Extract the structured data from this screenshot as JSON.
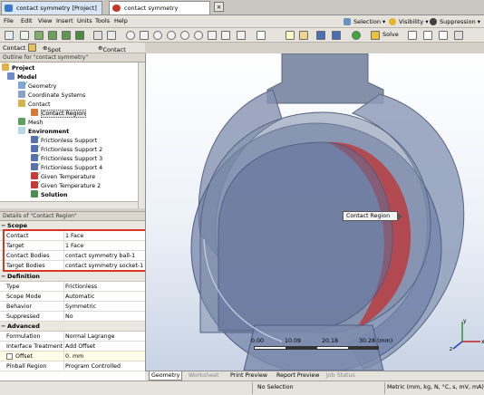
{
  "tabs": [
    {
      "label": "contact symmetry [Project]"
    },
    {
      "label": "contact symmetry [Simulation]"
    }
  ],
  "menu": [
    "File",
    "Edit",
    "View",
    "Insert",
    "Units",
    "Tools",
    "Help"
  ],
  "menu_right": {
    "selection": "Selection",
    "visibility": "Visibility",
    "suppression": "Suppression"
  },
  "toolbar": {
    "solve": "Solve"
  },
  "context_bar": {
    "contact": "Contact",
    "spot_weld": "Spot Weld",
    "contact2": "Contact"
  },
  "outline": {
    "title": "Outline for \"contact symmetry\"",
    "items": [
      {
        "label": "Project"
      },
      {
        "label": "Model"
      },
      {
        "label": "Geometry"
      },
      {
        "label": "Coordinate Systems"
      },
      {
        "label": "Contact"
      },
      {
        "label": "Contact Region"
      },
      {
        "label": "Mesh"
      },
      {
        "label": "Environment"
      },
      {
        "label": "Frictionless Support"
      },
      {
        "label": "Frictionless Support 2"
      },
      {
        "label": "Frictionless Support 3"
      },
      {
        "label": "Frictionless Support 4"
      },
      {
        "label": "Given Temperature"
      },
      {
        "label": "Given Temperature 2"
      },
      {
        "label": "Solution"
      }
    ]
  },
  "details": {
    "title": "Details of \"Contact Region\"",
    "sections": [
      {
        "label": "Scope"
      },
      {
        "label": "Definition"
      },
      {
        "label": "Advanced"
      }
    ],
    "rows": [
      {
        "key": "Contact",
        "value": "1 Face"
      },
      {
        "key": "Target",
        "value": "1 Face"
      },
      {
        "key": "Contact Bodies",
        "value": "contact symmetry ball-1"
      },
      {
        "key": "Target Bodies",
        "value": "contact symmetry socket-1"
      },
      {
        "key": "Type",
        "value": "Frictionless"
      },
      {
        "key": "Scope Mode",
        "value": "Automatic"
      },
      {
        "key": "Behavior",
        "value": "Symmetric"
      },
      {
        "key": "Suppressed",
        "value": "No"
      },
      {
        "key": "Formulation",
        "value": "Normal Lagrange"
      },
      {
        "key": "Interface Treatment",
        "value": "Add Offset"
      },
      {
        "key": "Offset",
        "value": "0. mm"
      },
      {
        "key": "Pinball Region",
        "value": "Program Controlled"
      }
    ]
  },
  "viewport": {
    "annotation": "Contact Region",
    "scale": {
      "t0": "0.00",
      "t1": "10.09",
      "t2": "20.18",
      "t3": "30.28 (mm)"
    }
  },
  "view_tabs": [
    {
      "label": "Geometry"
    },
    {
      "label": "Worksheet"
    },
    {
      "label": "Print Preview"
    },
    {
      "label": "Report Preview"
    },
    {
      "label": "Job Status"
    }
  ],
  "statusbar": {
    "selection": "No Selection",
    "units": "Metric (mm, kg, N, °C, s, mV, mA)"
  },
  "colors": {
    "highlight": "#e03422",
    "accent": "#3b78c8",
    "contact_red": "#c03030",
    "body_blue": "#7d8ca6"
  }
}
